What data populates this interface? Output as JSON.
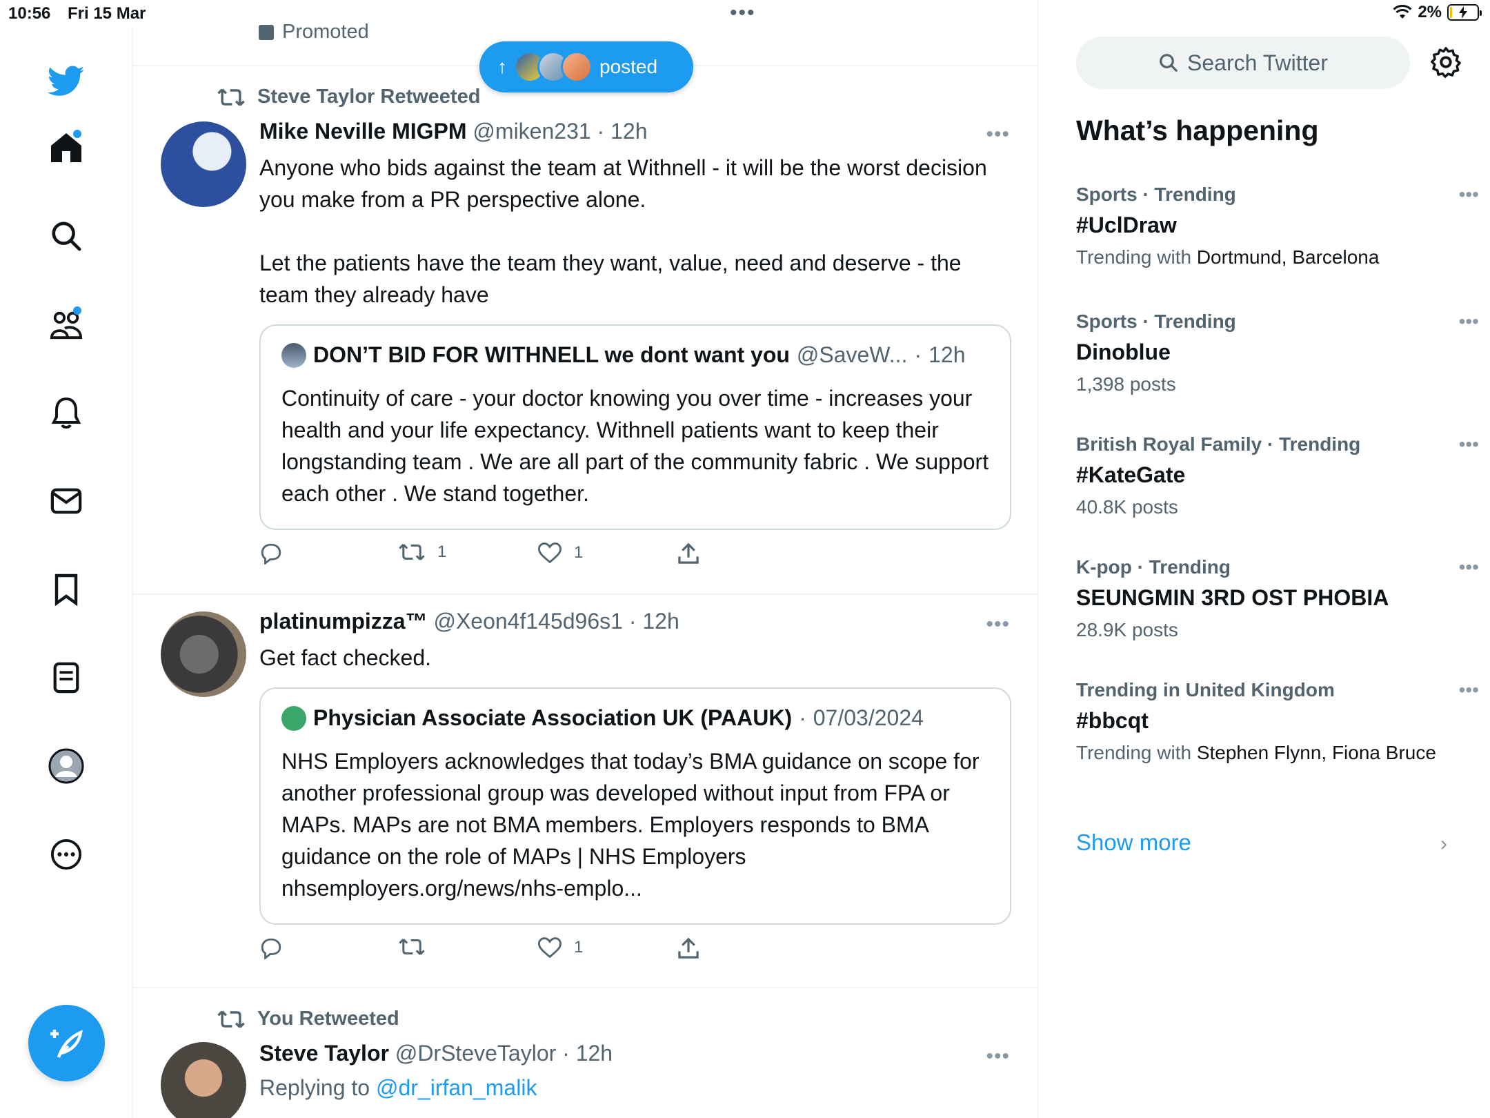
{
  "status": {
    "time": "10:56",
    "date": "Fri 15 Mar",
    "battery": "2%"
  },
  "nav": {
    "items": [
      "home",
      "explore",
      "communities",
      "notifications",
      "messages",
      "bookmarks",
      "lists",
      "profile",
      "more"
    ]
  },
  "timeline": {
    "promoted_label": "Promoted",
    "new_posts_pill": {
      "label": "posted"
    },
    "tweets": [
      {
        "social_context": "Steve Taylor Retweeted",
        "name": "Mike Neville MIGPM",
        "handle": "@miken231",
        "time": "12h",
        "text": "Anyone who bids against the team at Withnell - it will be the worst decision you make from a PR perspective alone.\n\nLet the patients have the team they want, value, need and deserve - the team they already have",
        "quote": {
          "name": "DON’T BID FOR WITHNELL we dont want you",
          "handle": "@SaveW...",
          "time": "12h",
          "text": "Continuity of care - your doctor knowing you over time - increases your health and your life expectancy. Withnell patients want to keep their longstanding team . We are all part of the community fabric . We support each other . We stand together."
        },
        "retweets": "1",
        "likes": "1"
      },
      {
        "name": "platinumpizza™",
        "handle": "@Xeon4f145d96s1",
        "time": "12h",
        "text": "Get fact checked.",
        "quote": {
          "name": "Physician Associate Association UK (PAAUK)",
          "time": "07/03/2024",
          "text": "NHS Employers acknowledges that today’s BMA guidance on scope for another professional group was developed without input from FPA or MAPs. MAPs are not BMA members. Employers responds to BMA guidance on the role of MAPs | NHS Employers nhsemployers.org/news/nhs-emplo..."
        },
        "retweets": "",
        "likes": "1"
      },
      {
        "social_context": "You Retweeted",
        "name": "Steve Taylor",
        "handle": "@DrSteveTaylor",
        "time": "12h",
        "replying_prefix": "Replying to",
        "replying_to": "@dr_irfan_malik"
      }
    ]
  },
  "sidebar": {
    "search_placeholder": "Search Twitter",
    "heading": "What’s happening",
    "trends": [
      {
        "meta": "Sports · Trending",
        "topic": "#UclDraw",
        "sub_prefix": "Trending with",
        "sub_names": "Dortmund, Barcelona"
      },
      {
        "meta": "Sports · Trending",
        "topic": "Dinoblue",
        "sub_prefix": "1,398 posts",
        "sub_names": ""
      },
      {
        "meta": "British Royal Family · Trending",
        "topic": "#KateGate",
        "sub_prefix": "40.8K posts",
        "sub_names": ""
      },
      {
        "meta": "K-pop · Trending",
        "topic": "SEUNGMIN 3RD OST PHOBIA",
        "sub_prefix": "28.9K posts",
        "sub_names": ""
      },
      {
        "meta": "Trending in United Kingdom",
        "topic": "#bbcqt",
        "sub_prefix": "Trending with",
        "sub_names": "Stephen Flynn, Fiona Bruce"
      }
    ],
    "show_more": "Show more"
  },
  "colors": {
    "accent": "#1d9bf0",
    "text": "#0f1419",
    "muted": "#536471",
    "border": "#eff3f4"
  }
}
